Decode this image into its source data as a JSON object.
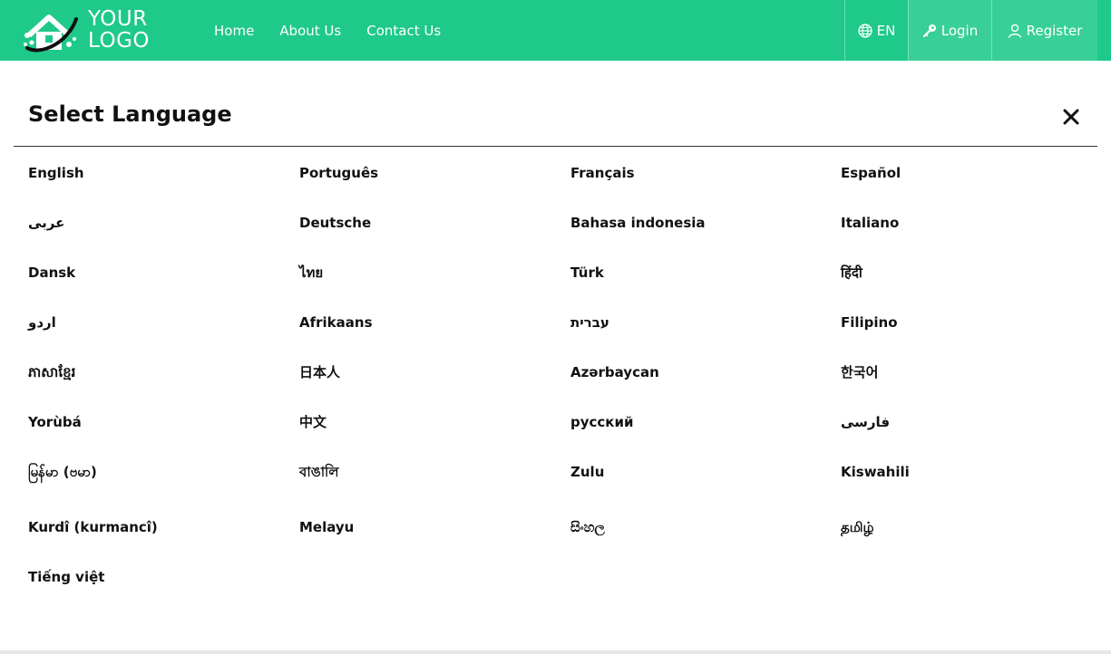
{
  "colors": {
    "brand": "#1ec98a",
    "text_dark": "#111111"
  },
  "logo": {
    "line1": "YOUR",
    "line2": "LOGO"
  },
  "nav": {
    "items": [
      "Home",
      "About Us",
      "Contact Us"
    ]
  },
  "header_actions": {
    "language": "EN",
    "login": "Login",
    "register": "Register",
    "icons": [
      "globe-icon",
      "key-icon",
      "user-icon"
    ]
  },
  "modal": {
    "title": "Select Language",
    "close_icon": "close-icon"
  },
  "languages": [
    "English",
    "Português",
    "Français",
    "Español",
    "عربى",
    "Deutsche",
    "Bahasa indonesia",
    "Italiano",
    "Dansk",
    "ไทย",
    "Türk",
    "हिंदी",
    "اردو",
    "Afrikaans",
    "עברית",
    "Filipino",
    "ភាសាខ្មែរ",
    "日本人",
    "Azərbaycan",
    "한국어",
    "Yorùbá",
    "中文",
    "русский",
    "فارسی",
    "မြန်မာ (ဗမာ)",
    "বাঙালি",
    "Zulu",
    "Kiswahili",
    "Kurdî (kurmancî)",
    "Melayu",
    "සිංහල",
    "தமிழ்",
    "Tiếng việt"
  ]
}
